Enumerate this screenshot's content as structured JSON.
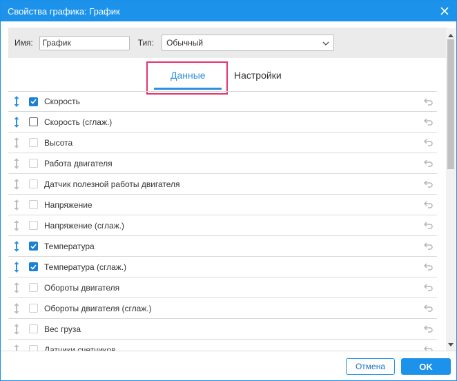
{
  "window": {
    "title": "Свойства графика: График"
  },
  "toolbar": {
    "name_label": "Имя:",
    "name_value": "График",
    "type_label": "Тип:",
    "type_value": "Обычный"
  },
  "tabs": [
    {
      "label": "Данные",
      "active": true
    },
    {
      "label": "Настройки",
      "active": false
    }
  ],
  "rows": [
    {
      "label": "Скорость",
      "checked": true,
      "enabled": true
    },
    {
      "label": "Скорость (сглаж.)",
      "checked": false,
      "enabled": true
    },
    {
      "label": "Высота",
      "checked": false,
      "enabled": false
    },
    {
      "label": "Работа двигателя",
      "checked": false,
      "enabled": false
    },
    {
      "label": "Датчик полезной работы двигателя",
      "checked": false,
      "enabled": false
    },
    {
      "label": "Напряжение",
      "checked": false,
      "enabled": false
    },
    {
      "label": "Напряжение (сглаж.)",
      "checked": false,
      "enabled": false
    },
    {
      "label": "Температура",
      "checked": true,
      "enabled": true
    },
    {
      "label": "Температура (сглаж.)",
      "checked": true,
      "enabled": true
    },
    {
      "label": "Обороты двигателя",
      "checked": false,
      "enabled": false
    },
    {
      "label": "Обороты двигателя (сглаж.)",
      "checked": false,
      "enabled": false
    },
    {
      "label": "Вес груза",
      "checked": false,
      "enabled": false
    },
    {
      "label": "Датчики счетчиков",
      "checked": false,
      "enabled": false
    }
  ],
  "footer": {
    "cancel_label": "Отмена",
    "ok_label": "OK"
  },
  "colors": {
    "accent": "#1c92ea",
    "highlight": "#e8326b",
    "checked": "#1b7fd4"
  }
}
